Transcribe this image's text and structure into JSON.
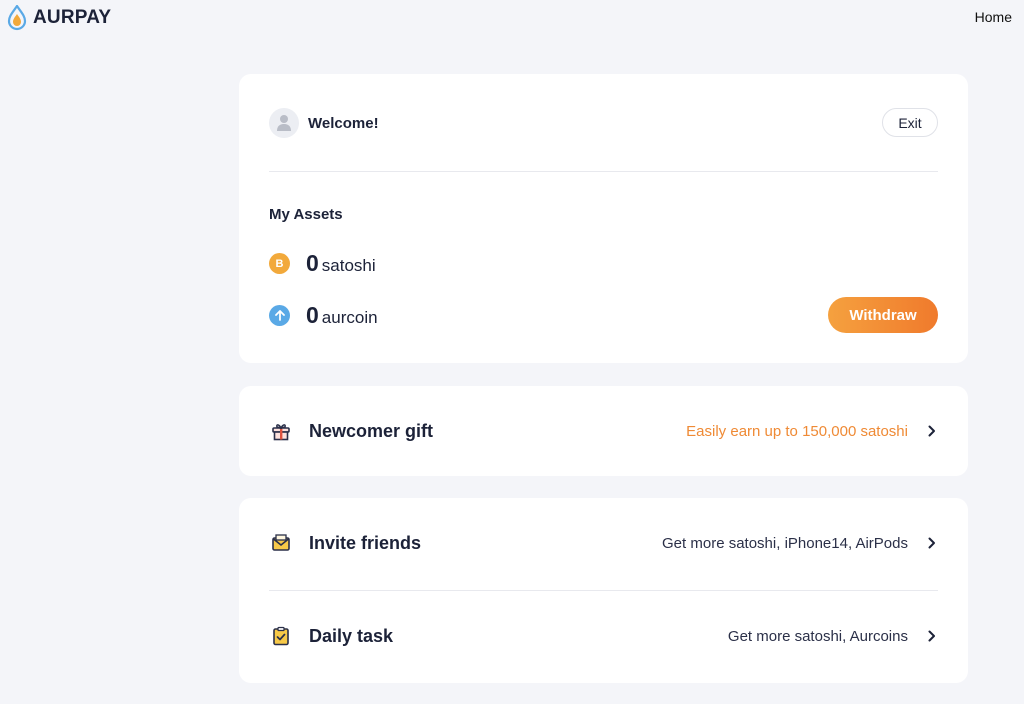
{
  "header": {
    "brand": "AURPAY",
    "nav_home": "Home"
  },
  "account": {
    "welcome": "Welcome!",
    "exit_label": "Exit"
  },
  "assets": {
    "title": "My Assets",
    "items": [
      {
        "amount": "0",
        "unit": "satoshi",
        "icon": "bitcoin-icon",
        "color": "#f2a93b"
      },
      {
        "amount": "0",
        "unit": "aurcoin",
        "icon": "aurcoin-icon",
        "color": "#5aa9e6"
      }
    ],
    "withdraw_label": "Withdraw"
  },
  "promos": {
    "gift": {
      "title": "Newcomer gift",
      "desc": "Easily earn up to 150,000 satoshi",
      "icon": "gift-icon"
    },
    "invite": {
      "title": "Invite friends",
      "desc": "Get more satoshi, iPhone14, AirPods",
      "icon": "envelope-icon"
    },
    "daily": {
      "title": "Daily task",
      "desc": "Get more satoshi, Aurcoins",
      "icon": "clipboard-icon"
    }
  },
  "colors": {
    "accent": "#f07a2c",
    "accent_text": "#ef8a35",
    "page_bg": "#f4f5f9",
    "text": "#1c2238"
  }
}
